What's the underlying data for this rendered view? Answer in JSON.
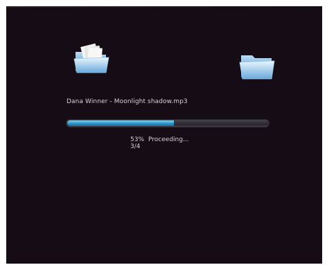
{
  "transfer": {
    "file_name": "Dana Winner - Moonlight shadow.mp3",
    "percent_label": "53%",
    "percent_value": 0.53,
    "status_text": "Proceeding...",
    "file_count": "3/4"
  },
  "icons": {
    "source": "source-folder-icon",
    "destination": "destination-folder-icon"
  },
  "colors": {
    "background": "#150c15",
    "progress_fill": "#2f9bd1",
    "folder_light": "#d8eefb",
    "folder_dark": "#4f93cf"
  }
}
